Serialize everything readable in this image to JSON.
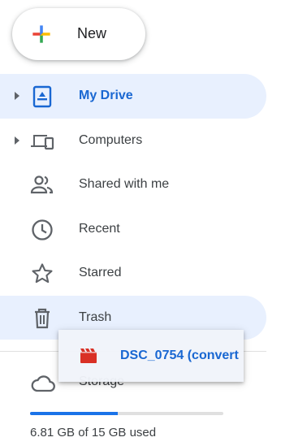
{
  "new_button": {
    "label": "New"
  },
  "nav": {
    "items": [
      {
        "label": "My Drive",
        "icon": "my-drive-icon",
        "active": true,
        "expandable": true
      },
      {
        "label": "Computers",
        "icon": "computers-icon",
        "active": false,
        "expandable": true
      },
      {
        "label": "Shared with me",
        "icon": "shared-with-me-icon",
        "active": false,
        "expandable": false
      },
      {
        "label": "Recent",
        "icon": "recent-clock-icon",
        "active": false,
        "expandable": false
      },
      {
        "label": "Starred",
        "icon": "star-icon",
        "active": false,
        "expandable": false
      },
      {
        "label": "Trash",
        "icon": "trash-icon",
        "active": false,
        "expandable": false,
        "hovered": true
      }
    ]
  },
  "storage": {
    "label": "Storage",
    "icon": "cloud-icon",
    "used_fraction": 0.454,
    "usage_text": "6.81 GB of 15 GB used"
  },
  "drag_item": {
    "label": "DSC_0754 (convert",
    "icon": "video-file-icon"
  },
  "colors": {
    "accent": "#1967d2",
    "active_bg": "#e8f0fe",
    "bar_fill": "#1a73e8",
    "video_icon": "#d93025"
  }
}
